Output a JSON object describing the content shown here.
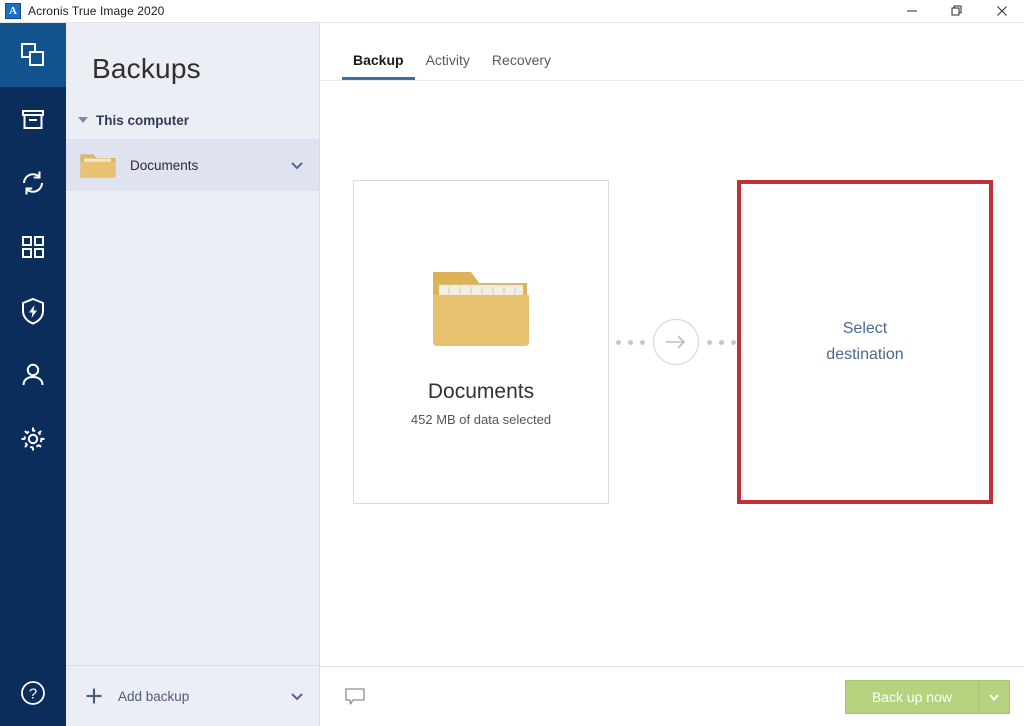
{
  "window": {
    "title": "Acronis True Image 2020",
    "app_icon": "acronis-a-icon",
    "app_icon_letter": "A",
    "controls": {
      "minimize": "minimize-icon",
      "restore": "restore-icon",
      "close": "close-icon"
    }
  },
  "rail": {
    "items": [
      {
        "name": "backup",
        "icon": "backup-layers-icon",
        "active": true
      },
      {
        "name": "archive",
        "icon": "archive-box-icon",
        "active": false
      },
      {
        "name": "sync",
        "icon": "sync-arrows-icon",
        "active": false
      },
      {
        "name": "tools",
        "icon": "grid-squares-icon",
        "active": false
      },
      {
        "name": "protection",
        "icon": "shield-bolt-icon",
        "active": false
      },
      {
        "name": "account",
        "icon": "person-icon",
        "active": false
      },
      {
        "name": "settings",
        "icon": "gear-icon",
        "active": false
      }
    ],
    "help": {
      "name": "help",
      "icon": "help-circle-icon"
    }
  },
  "listpane": {
    "title": "Backups",
    "group": {
      "label": "This computer",
      "expanded": true,
      "toggle_icon": "triangle-down-icon"
    },
    "items": [
      {
        "label": "Documents",
        "icon": "folder-icon",
        "selected": true,
        "chevron_icon": "chevron-down-icon"
      }
    ],
    "add_backup": {
      "label": "Add backup",
      "plus_icon": "plus-icon",
      "chevron_icon": "chevron-down-icon"
    }
  },
  "tabs": [
    {
      "label": "Backup",
      "active": true
    },
    {
      "label": "Activity",
      "active": false
    },
    {
      "label": "Recovery",
      "active": false
    }
  ],
  "source_panel": {
    "icon": "open-folder-documents-icon",
    "title": "Documents",
    "subtitle": "452 MB of data selected"
  },
  "connector": {
    "arrow_icon": "arrow-right-circle-icon",
    "left_dots": 3,
    "right_dots": 3
  },
  "destination_panel": {
    "label_line1": "Select",
    "label_line2": "destination",
    "highlight_color": "#c13039",
    "highlighted": true
  },
  "bottombar": {
    "comment_icon": "speech-bubble-icon",
    "backup_now": {
      "label": "Back up now",
      "color": "#b5d37e",
      "dropdown_icon": "chevron-down-icon"
    }
  },
  "colors": {
    "rail_bg": "#0b2d5c",
    "rail_active": "#12538f",
    "listpane_bg": "#eceef5",
    "selected_item_bg": "#dfe3f0",
    "tab_underline": "#3a6ea5",
    "accent_red": "#c13039",
    "accent_green": "#b5d37e",
    "folder_gold": "#e6c06a"
  }
}
